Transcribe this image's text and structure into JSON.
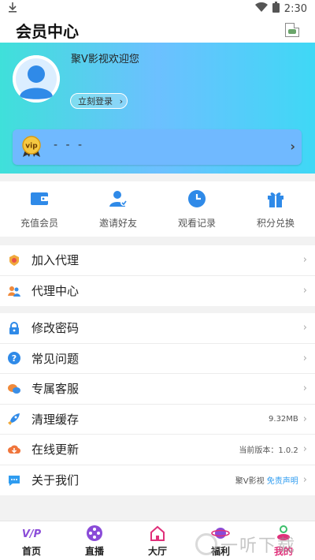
{
  "status_bar": {
    "time": "2:30"
  },
  "app_bar": {
    "title": "会员中心"
  },
  "profile": {
    "greeting": "聚V影视欢迎您",
    "login_button": "立刻登录"
  },
  "vip": {
    "badge_text": "vip",
    "placeholder": "- - -"
  },
  "quick_actions": [
    {
      "label": "充值会员",
      "icon": "wallet-icon"
    },
    {
      "label": "邀请好友",
      "icon": "invite-user-icon"
    },
    {
      "label": "观看记录",
      "icon": "history-clock-icon"
    },
    {
      "label": "积分兑换",
      "icon": "gift-icon"
    }
  ],
  "agent_menu": [
    {
      "label": "加入代理",
      "icon": "agent-badge-icon"
    },
    {
      "label": "代理中心",
      "icon": "users-icon"
    }
  ],
  "settings_menu": [
    {
      "label": "修改密码",
      "icon": "lock-icon",
      "value": ""
    },
    {
      "label": "常见问题",
      "icon": "question-icon",
      "value": ""
    },
    {
      "label": "专属客服",
      "icon": "chat-bubbles-icon",
      "value": ""
    },
    {
      "label": "清理缓存",
      "icon": "rocket-icon",
      "value": "9.32MB"
    },
    {
      "label": "在线更新",
      "icon": "cloud-download-icon",
      "value": "当前版本：1.0.2"
    },
    {
      "label": "关于我们",
      "icon": "message-icon",
      "value": "聚V影视",
      "value_link": "免责声明"
    }
  ],
  "tabs": [
    {
      "label": "首页",
      "icon": "vip-logo-icon"
    },
    {
      "label": "直播",
      "icon": "live-film-icon"
    },
    {
      "label": "大厅",
      "icon": "home-icon"
    },
    {
      "label": "福利",
      "icon": "planet-icon"
    },
    {
      "label": "我的",
      "icon": "profile-icon",
      "active": true
    }
  ],
  "watermark": {
    "text": "一听下载"
  },
  "colors": {
    "vip_card": "#70b9ff",
    "active_tab": "#e0307a",
    "hero_start": "#3fe0da",
    "hero_end": "#3fd8f5"
  }
}
